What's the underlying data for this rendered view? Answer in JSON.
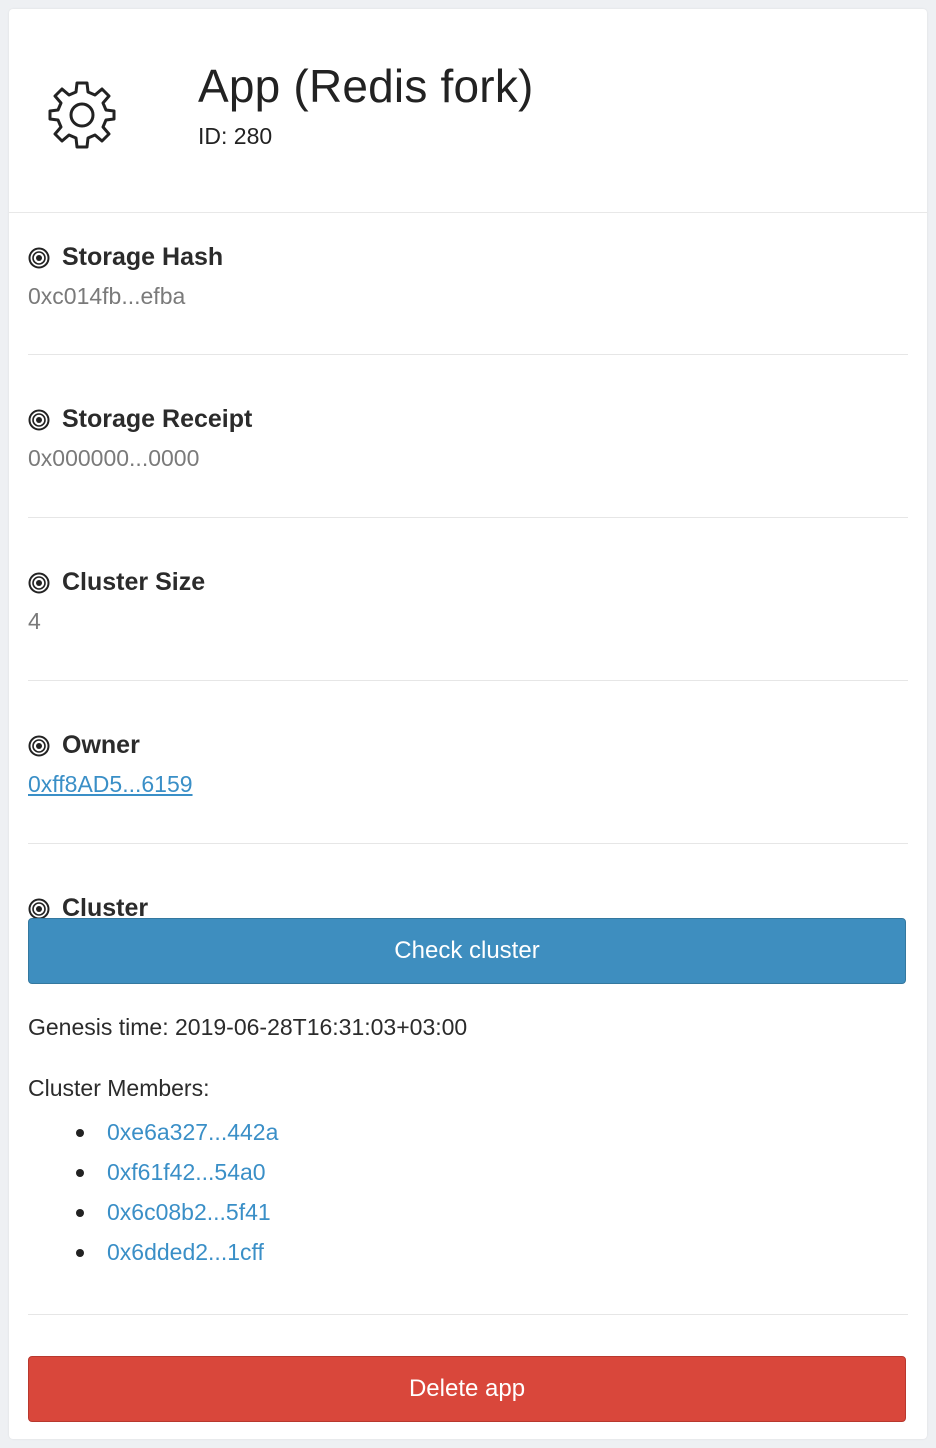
{
  "app": {
    "title": "App (Redis fork)",
    "id_text": "ID: 280",
    "icon": "gear-icon"
  },
  "fields": {
    "storage_hash": {
      "label": "Storage Hash",
      "value": "0xc014fb...efba"
    },
    "storage_receipt": {
      "label": "Storage Receipt",
      "value": "0x000000...0000"
    },
    "cluster_size": {
      "label": "Cluster Size",
      "value": "4"
    },
    "owner": {
      "label": "Owner",
      "value": "0xff8AD5...6159"
    }
  },
  "cluster": {
    "label": "Cluster",
    "check_button": "Check cluster",
    "genesis": "Genesis time: 2019-06-28T16:31:03+03:00",
    "members_label": "Cluster Members:",
    "members": [
      "0xe6a327...442a",
      "0xf61f42...54a0",
      "0x6c08b2...5f41",
      "0x6dded2...1cff"
    ]
  },
  "actions": {
    "delete_button": "Delete app"
  },
  "colors": {
    "primary_button": "#3e8ebf",
    "danger_button": "#d9473b",
    "link": "#3a8fc7"
  }
}
